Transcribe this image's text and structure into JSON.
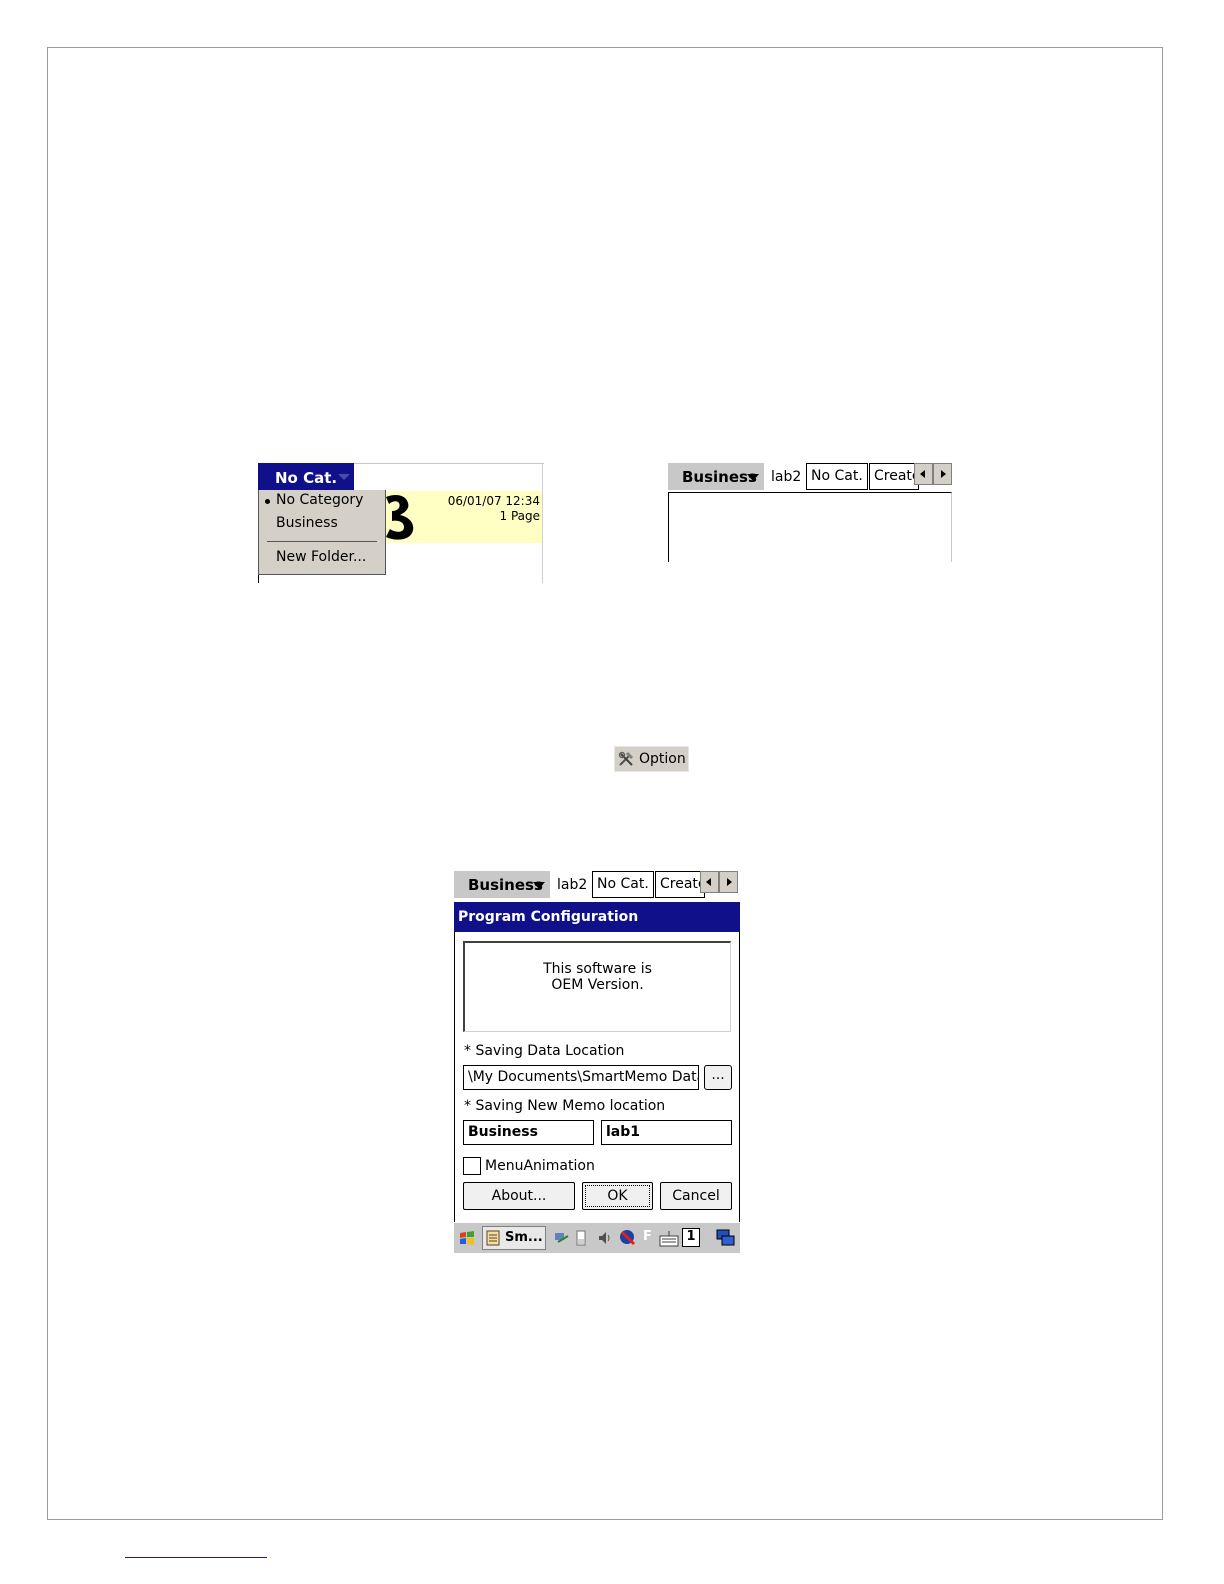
{
  "shot_category_menu": {
    "header_label": "No Cat.",
    "memo": {
      "date": "06/01/07 12:34",
      "pages": "1 Page"
    },
    "menu_items": [
      "No Category",
      "Business",
      "New Folder..."
    ]
  },
  "shot_tab_bar": {
    "category_label": "Business",
    "tabs": [
      "lab2",
      "No Cat.",
      "Create"
    ]
  },
  "option_button": {
    "label": "Option"
  },
  "shot_config_dialog": {
    "category_label": "Business",
    "tabs": [
      "lab2",
      "No Cat.",
      "Create"
    ],
    "title": "Program Configuration",
    "info_line1": "This software is",
    "info_line2": "OEM Version.",
    "data_location_label": "* Saving Data Location",
    "data_location_value": "\\My Documents\\SmartMemo Datas",
    "browse_label": "...",
    "memo_location_label": "* Saving New Memo location",
    "memo_category_value": "Business",
    "memo_folder_value": "lab1",
    "menu_animation_label": "MenuAnimation",
    "menu_animation_checked": false,
    "about_label": "About...",
    "ok_label": "OK",
    "cancel_label": "Cancel",
    "taskbar": {
      "app_label": "Sm...",
      "f_label": "F",
      "input_label": "1"
    }
  },
  "colors": {
    "title_bar": "#10108a",
    "memo_bg": "#ffffc4",
    "chrome": "#d4d0c8"
  }
}
